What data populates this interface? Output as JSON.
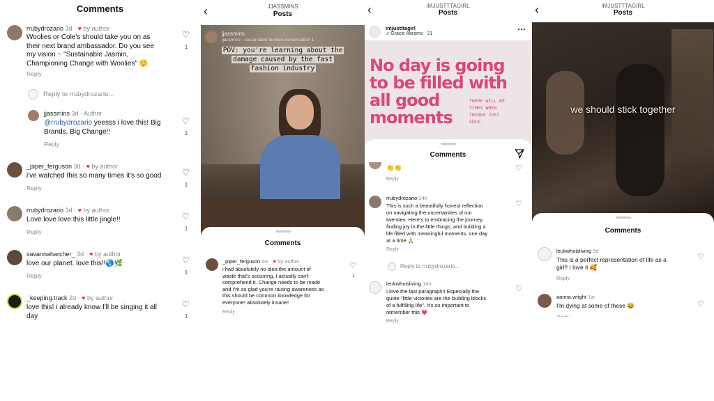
{
  "panel1": {
    "title": "Comments",
    "comments": [
      {
        "user": "rrubydrozario",
        "age": "3d",
        "by": "by author",
        "text1": "Woolies or Cole's should take you on as",
        "text2": "their next brand ambassador.  Do you see",
        "text3": "my vision ~ \"Sustainable Jasmin,",
        "text4": "Championing Change with Woolies\" 😌",
        "reply": "Reply",
        "likes": "1"
      },
      {
        "reply_to": "Reply to rrubydrozario..."
      },
      {
        "user": "jjassmins",
        "age": "3d",
        "by": "Author",
        "mention": "@rrubydrozario",
        "text1": " yeesss i love this! Big",
        "text2": "Brands, Big Change!!",
        "reply": "Reply",
        "likes": "1"
      },
      {
        "user": "_piper_ferguson",
        "age": "3d",
        "by": "by author",
        "text1": "i've watched this so many times it's so good",
        "reply": "Reply",
        "likes": "1"
      },
      {
        "user": "rrubydrozario",
        "age": "3d",
        "by": "by author",
        "text1": "Love love love this little jingle!!",
        "reply": "Reply",
        "likes": "1"
      },
      {
        "user": "savannaharcher_",
        "age": "3d",
        "by": "by author",
        "text1": "love our planet. love this!!🌏🌿",
        "reply": "Reply",
        "likes": "1"
      },
      {
        "user": "_keeping.track",
        "age": "2d",
        "by": "by author",
        "text1": "love this! i already know I'll be singing it all",
        "text2": "day",
        "likes": "1"
      }
    ]
  },
  "panel2": {
    "header_small": "JJASSMINS",
    "header_big": "Posts",
    "poster": "jjassmins",
    "poster_sub": "jjassmins · sustainable fashion conversation 1",
    "caption1": "POV: you're learning about the",
    "caption2": "damage caused by the fast",
    "caption3": "fashion industry",
    "sheet_title": "Comments",
    "comment": {
      "user": "_piper_ferguson",
      "age": "4w",
      "by": "by author",
      "lines": [
        "i had absolutely no idea the amount of",
        "waste that's occurring, I actually can't",
        "comprehend it. Change needs to be made",
        "and I'm so glad you're raising awareness as",
        "this should be common knowledge for",
        "everyone! absolutely insane!"
      ],
      "reply": "Reply",
      "likes": "1"
    }
  },
  "panel3": {
    "header_small": "IMJUSTTTAGIRL",
    "header_big": "Posts",
    "poster": "imjustttagirl",
    "song": "♫ Gracie Abrams · 21",
    "big1": "No day is going",
    "big2": "to be filled with",
    "big3": "all good",
    "big4": "moments",
    "side1": "THERE WILL BE",
    "side2": "TIMES WHEN",
    "side3": "THINGS JUST",
    "side4": "SUCK.",
    "sheet_title": "Comments",
    "top_emoji": "👏👏",
    "top_reply": "Reply",
    "c1": {
      "user": "rrubydrozario",
      "age": "14h",
      "lines": [
        "This is such a beautifully honest reflection",
        "on navigating the uncertainties of our",
        "twenties. Here's to embracing the journey,",
        "finding joy in the little things, and building a",
        "life filled with meaningful moments, one day",
        "at a time 🙏"
      ],
      "reply": "Reply"
    },
    "reply_to": "Reply to rrubydrozario...",
    "c2": {
      "user": "leukwhoisliving",
      "age": "14h",
      "lines": [
        "I love the last paragraph!! Especially the",
        "quote \"little victories are the building blocks",
        "of a fulfilling life\". It's so important to",
        "remember this 💗"
      ],
      "reply": "Reply"
    }
  },
  "panel4": {
    "header_small": "IMJUSTTTAGIRL",
    "header_big": "Posts",
    "overlay": "we should stick together",
    "sheet_title": "Comments",
    "c1": {
      "user": "leukwhoisliving",
      "age": "5d",
      "lines": [
        "This is a perfect representation of life as a",
        "girl!! I love it 🥰"
      ],
      "reply": "Reply"
    },
    "c2": {
      "user": "aanna.wright",
      "age": "1w",
      "lines": [
        "I'm dying at some of these 😂"
      ],
      "reply": "Reply"
    }
  },
  "colors": {
    "heart": "#e0245e",
    "link": "#2c5d9c",
    "pink_text": "#d8487a"
  }
}
